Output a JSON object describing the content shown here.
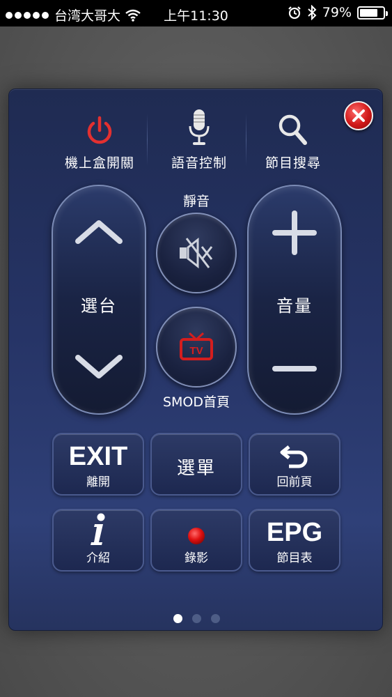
{
  "status_bar": {
    "carrier": "台湾大哥大",
    "time": "上午11:30",
    "battery": "79%",
    "battery_level": 0.79
  },
  "top_row": [
    {
      "label": "機上盒開關",
      "icon": "power-icon"
    },
    {
      "label": "語音控制",
      "icon": "microphone-icon"
    },
    {
      "label": "節目搜尋",
      "icon": "search-icon"
    }
  ],
  "channel": {
    "label": "選台"
  },
  "volume": {
    "label": "音量"
  },
  "mute": {
    "label": "靜音"
  },
  "smod": {
    "label": "SMOD首頁"
  },
  "buttons": {
    "exit": {
      "big": "EXIT",
      "small": "離開"
    },
    "menu": {
      "label": "選單"
    },
    "back": {
      "small": "回前頁"
    },
    "info": {
      "small": "介紹"
    },
    "record": {
      "small": "錄影"
    },
    "epg": {
      "big": "EPG",
      "small": "節目表"
    }
  },
  "pager": {
    "count": 3,
    "active": 0
  },
  "colors": {
    "accent_red": "#d01919",
    "panel": "#263466"
  }
}
